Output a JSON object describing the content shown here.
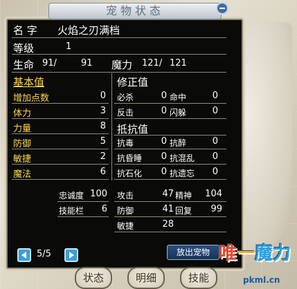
{
  "title": "宠物状态",
  "pet": {
    "name_label": "名 字",
    "name": "火焰之刃满档",
    "level_label": "等级",
    "level": "1",
    "hp_label": "生命",
    "hp_cur": "91/",
    "hp_max": "91",
    "mp_label": "魔力",
    "mp_cur": "121/",
    "mp_max": "121"
  },
  "base": {
    "header": "基本值",
    "rows": [
      {
        "label": "增加点数",
        "value": "0"
      },
      {
        "label": "体力",
        "value": "3"
      },
      {
        "label": "力量",
        "value": "8"
      },
      {
        "label": "防御",
        "value": "5"
      },
      {
        "label": "敏捷",
        "value": "2"
      },
      {
        "label": "魔法",
        "value": "6"
      }
    ]
  },
  "correction": {
    "header": "修正值",
    "rows": [
      {
        "l1": "必杀",
        "v1": "0",
        "l2": "命中",
        "v2": "0"
      },
      {
        "l1": "反击",
        "v1": "0",
        "l2": "闪躲",
        "v2": "0"
      }
    ]
  },
  "resist": {
    "header": "抵抗值",
    "rows": [
      {
        "l1": "抗毒",
        "v1": "0",
        "l2": "抗醉",
        "v2": "0"
      },
      {
        "l1": "抗昏睡",
        "v1": "0",
        "l2": "抗混乱",
        "v2": "0"
      },
      {
        "l1": "抗石化",
        "v1": "0",
        "l2": "抗遗忘",
        "v2": "0"
      }
    ]
  },
  "misc": {
    "loyalty_label": "忠诚度",
    "loyalty": "100",
    "skill_label": "技能栏",
    "skill": "6"
  },
  "combat": {
    "atk_label": "攻击",
    "atk": "47",
    "spirit_label": "精神",
    "spirit": "104",
    "def_label": "防御",
    "def": "41",
    "recover_label": "回复",
    "recover": "99",
    "agi_label": "敏捷",
    "agi": "28"
  },
  "pager": {
    "text": "5/5"
  },
  "buttons": {
    "release": "放出宠物",
    "tab_status": "状态",
    "tab_detail": "明细",
    "tab_skill": "技能"
  },
  "logo": {
    "text1": "唯",
    "text2": "一",
    "text3": "魔力",
    "url": "pkml.cn"
  }
}
